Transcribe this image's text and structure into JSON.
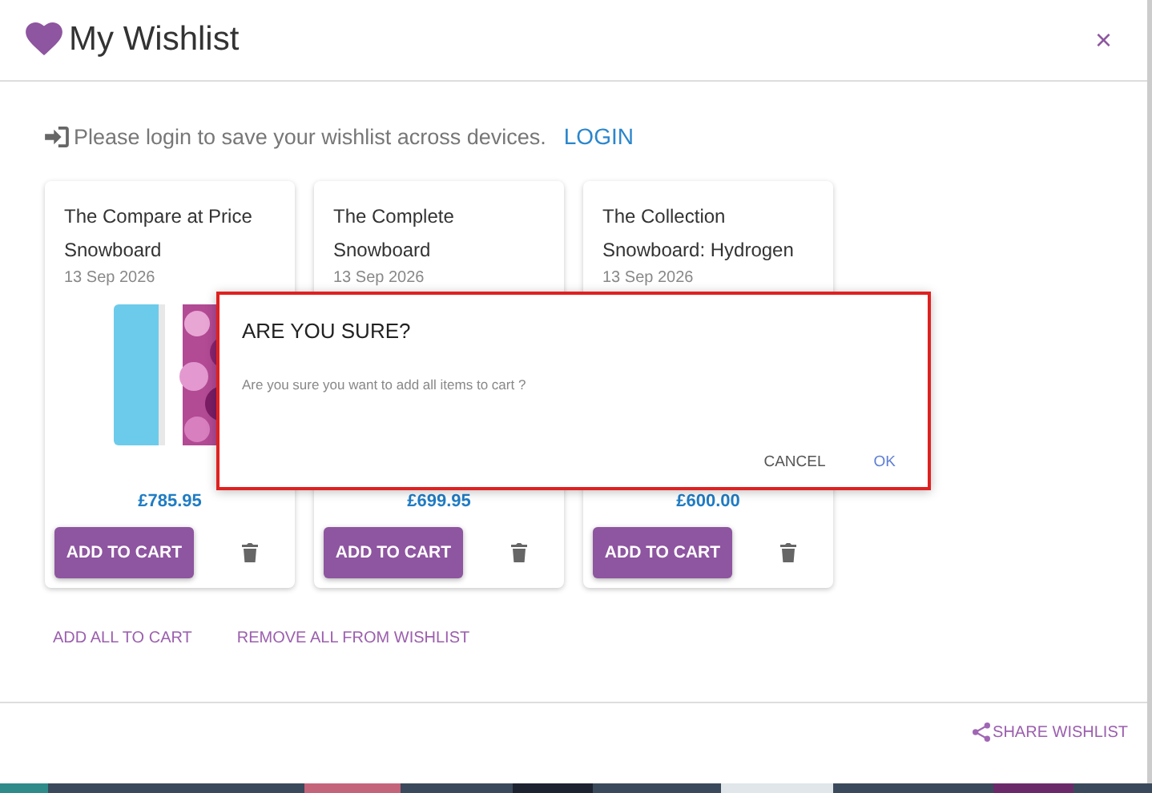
{
  "header": {
    "title": "My Wishlist",
    "close": "×"
  },
  "login_notice": {
    "text": "Please login to save your wishlist across devices.",
    "link": "LOGIN"
  },
  "products": [
    {
      "title": "The Compare at Price Snowboard",
      "date": "13 Sep 2026",
      "price": "£785.95",
      "button": "ADD TO CART"
    },
    {
      "title": "The Complete Snowboard",
      "date": "13 Sep 2026",
      "price": "£699.95",
      "button": "ADD TO CART"
    },
    {
      "title": "The Collection Snowboard: Hydrogen",
      "date": "13 Sep 2026",
      "price": "£600.00",
      "button": "ADD TO CART"
    }
  ],
  "actions": [
    "ADD ALL TO CART",
    "REMOVE ALL FROM WISHLIST"
  ],
  "footer": {
    "share": "SHARE WISHLIST"
  },
  "dialog": {
    "title": "ARE YOU SURE?",
    "message": "Are you sure you want to add all items to cart ?",
    "buttons": [
      {
        "label": "CANCEL",
        "kind": "secondary"
      },
      {
        "label": "OK",
        "kind": "primary"
      }
    ]
  }
}
